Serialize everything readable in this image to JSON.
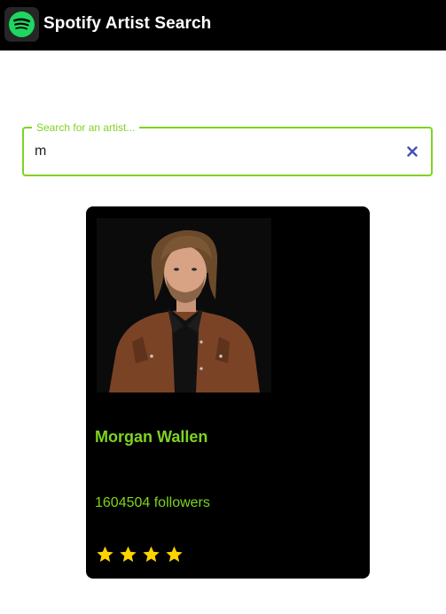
{
  "header": {
    "app_title": "Spotify Artist Search",
    "logo_icon": "spotify-logo-icon"
  },
  "search": {
    "legend": "Search for an artist...",
    "value": "m",
    "clear_icon": "close-icon",
    "accent_color": "#7ed321"
  },
  "results": [
    {
      "name": "Morgan Wallen",
      "followers_text": "1604504 followers",
      "rating_stars": 4,
      "rating_max": 5,
      "image_icon": "artist-photo"
    }
  ],
  "colors": {
    "brand_green": "#1ed760",
    "accent_green": "#7ed321",
    "star_yellow": "#ffd400",
    "card_bg": "#000000"
  }
}
